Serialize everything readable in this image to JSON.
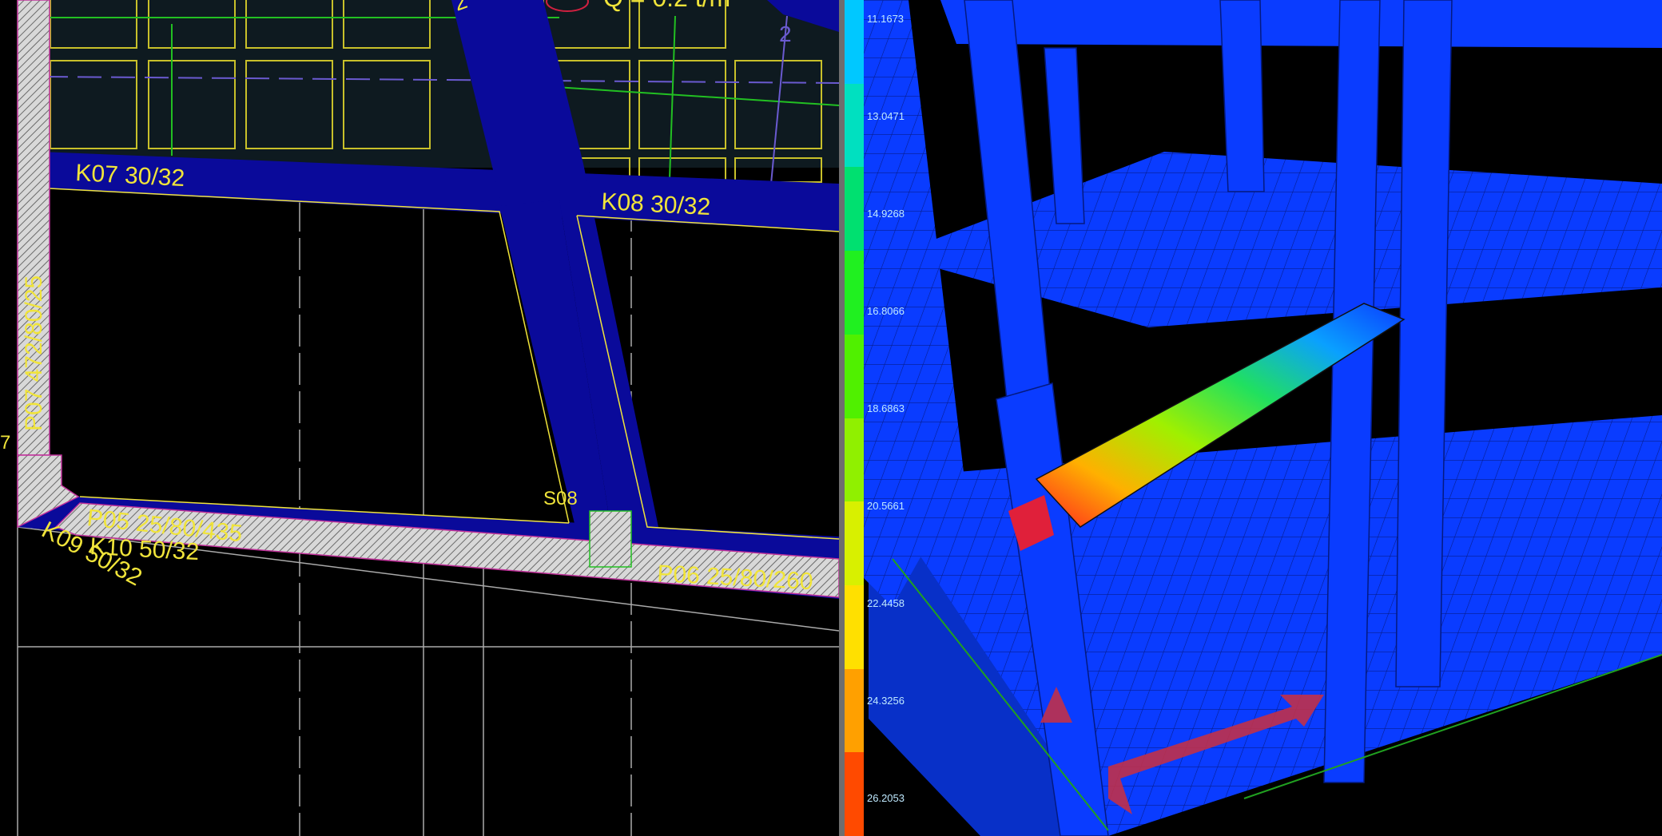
{
  "cad": {
    "load_label": "Q = 0.2 t/m",
    "axis_top": "2",
    "axis_right": "2",
    "edge_number": "7",
    "beam_k07": "K07 30/32",
    "beam_k08": "K08 30/32",
    "beam_k09": "K09 50/32",
    "beam_k10": "K10 50/32",
    "column_p05": "P05 25/80/435",
    "column_p06": "P06 25/80/260",
    "column_p07": "P07 472/80/25",
    "slab_s08": "S08"
  },
  "legend": {
    "values": [
      "11.1673",
      "13.0471",
      "14.9268",
      "16.8066",
      "18.6863",
      "20.5661",
      "22.4458",
      "24.3256",
      "26.2053"
    ],
    "colors": [
      "#00c8ff",
      "#00e0c0",
      "#00e070",
      "#20f020",
      "#50f000",
      "#90f000",
      "#d8f000",
      "#ffe000",
      "#ffa000",
      "#ff4a00"
    ]
  },
  "colors": {
    "beam_blue": "#0a0a9a",
    "cad_yellow": "#f0e43a",
    "cad_green": "#22c022",
    "slab_teal": "#0e1a20",
    "model_blue": "#0a3cff",
    "axis_red": "#c0304a"
  }
}
